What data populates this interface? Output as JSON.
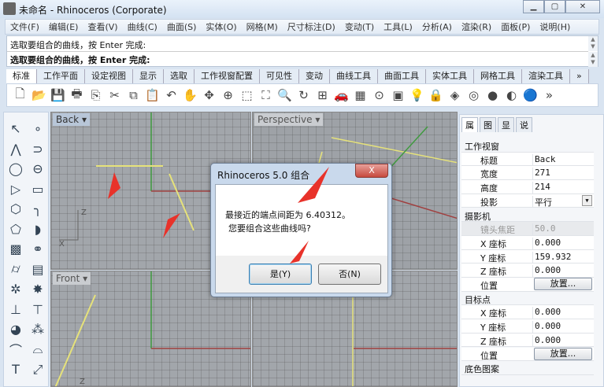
{
  "window": {
    "title": "未命名 - Rhinoceros (Corporate)",
    "controls": [
      "minimize",
      "maximize",
      "close"
    ]
  },
  "menu": [
    "文件(F)",
    "编辑(E)",
    "查看(V)",
    "曲线(C)",
    "曲面(S)",
    "实体(O)",
    "网格(M)",
    "尺寸标注(D)",
    "变动(T)",
    "工具(L)",
    "分析(A)",
    "渲染(R)",
    "面板(P)",
    "说明(H)"
  ],
  "command": {
    "history": "选取要组合的曲线，按 Enter 完成:",
    "prompt": "选取要组合的曲线，按 Enter 完成:"
  },
  "tabs": [
    "标准",
    "工作平面",
    "设定视图",
    "显示",
    "选取",
    "工作视窗配置",
    "可见性",
    "变动",
    "曲线工具",
    "曲面工具",
    "实体工具",
    "网格工具",
    "渲染工具",
    "»"
  ],
  "toolbar_icons": [
    "new-file",
    "open-folder",
    "save",
    "print",
    "import",
    "cut",
    "copy",
    "paste",
    "undo",
    "pan-hand",
    "rotate-view",
    "zoom-in",
    "zoom-window",
    "zoom-extents",
    "zoom-selected",
    "rotate",
    "four-viewports",
    "car-render",
    "grid-snap",
    "circle-point",
    "layer",
    "light-bulb",
    "lock",
    "material",
    "color-wheel",
    "sphere-shaded",
    "sphere-ghost",
    "sphere-render",
    "more"
  ],
  "toolbox_icons": [
    "select-arrow",
    "point",
    "polyline",
    "curve-control-points",
    "circle",
    "ellipse",
    "polygon",
    "rectangle",
    "polygon-center",
    "fillet-curve",
    "surface-points",
    "surface-patch",
    "box",
    "sphere-boolean",
    "cylinder",
    "mesh",
    "puzzle-tools",
    "explode",
    "trim",
    "split",
    "boolean-union",
    "points-group",
    "arc",
    "offset",
    "text",
    "transform"
  ],
  "viewports": [
    {
      "name": "Back",
      "axis": [
        "Z",
        "X"
      ]
    },
    {
      "name": "Perspective"
    },
    {
      "name": "Front",
      "axis": [
        "Z"
      ]
    },
    {
      "name": ""
    }
  ],
  "panel": {
    "tabs": [
      "属",
      "图",
      "显",
      "说"
    ],
    "sections": [
      {
        "title": "工作视窗",
        "rows": [
          {
            "k": "标题",
            "v": "Back"
          },
          {
            "k": "宽度",
            "v": "271"
          },
          {
            "k": "高度",
            "v": "214"
          },
          {
            "k": "投影",
            "v": "平行"
          }
        ]
      },
      {
        "title": "摄影机",
        "rows": [
          {
            "k": "镜头焦距",
            "v": "50.0"
          },
          {
            "k": "X 座标",
            "v": "0.000"
          },
          {
            "k": "Y 座标",
            "v": "159.932"
          },
          {
            "k": "Z 座标",
            "v": "0.000"
          },
          {
            "k": "位置",
            "v": "放置..."
          }
        ]
      },
      {
        "title": "目标点",
        "rows": [
          {
            "k": "X 座标",
            "v": "0.000"
          },
          {
            "k": "Y 座标",
            "v": "0.000"
          },
          {
            "k": "Z 座标",
            "v": "0.000"
          },
          {
            "k": "位置",
            "v": "放置..."
          }
        ]
      },
      {
        "title": "底色图案"
      }
    ]
  },
  "dialog": {
    "title": "Rhinoceros 5.0  组合",
    "close": "X",
    "message1": "最接近的端点间距为 6.40312。",
    "message2": "您要组合这些曲线吗?",
    "yes": "是(Y)",
    "no": "否(N)"
  },
  "colors": {
    "curve": "#e6e27a",
    "x_axis": "#a04040",
    "y_axis": "#3f9a3f",
    "arrow": "#e8322a"
  }
}
